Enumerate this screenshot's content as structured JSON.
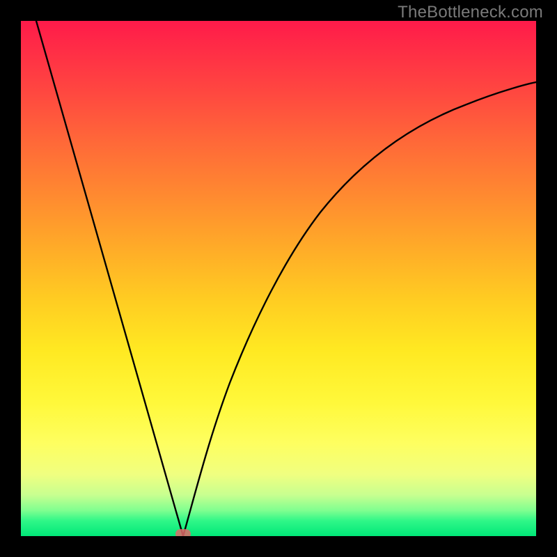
{
  "watermark": "TheBottleneck.com",
  "chart_data": {
    "type": "line",
    "title": "",
    "xlabel": "",
    "ylabel": "",
    "xlim": [
      0,
      100
    ],
    "ylim": [
      0,
      100
    ],
    "grid": false,
    "legend": false,
    "series": [
      {
        "name": "bottleneck-curve",
        "x": [
          3,
          6,
          10,
          14,
          18,
          22,
          26,
          28,
          30,
          31,
          32,
          33,
          35,
          38,
          42,
          48,
          55,
          63,
          72,
          82,
          92,
          100
        ],
        "y": [
          100,
          90,
          78,
          66,
          54,
          42,
          28,
          18,
          8,
          2,
          0,
          2,
          10,
          22,
          36,
          50,
          60,
          68,
          74,
          79,
          83,
          86
        ]
      }
    ],
    "marker": {
      "x": 31.5,
      "y": 0,
      "color": "#e06a6a"
    },
    "gradient": {
      "top": "#ff1a4a",
      "mid": "#ffe020",
      "bottom": "#00e878"
    }
  }
}
